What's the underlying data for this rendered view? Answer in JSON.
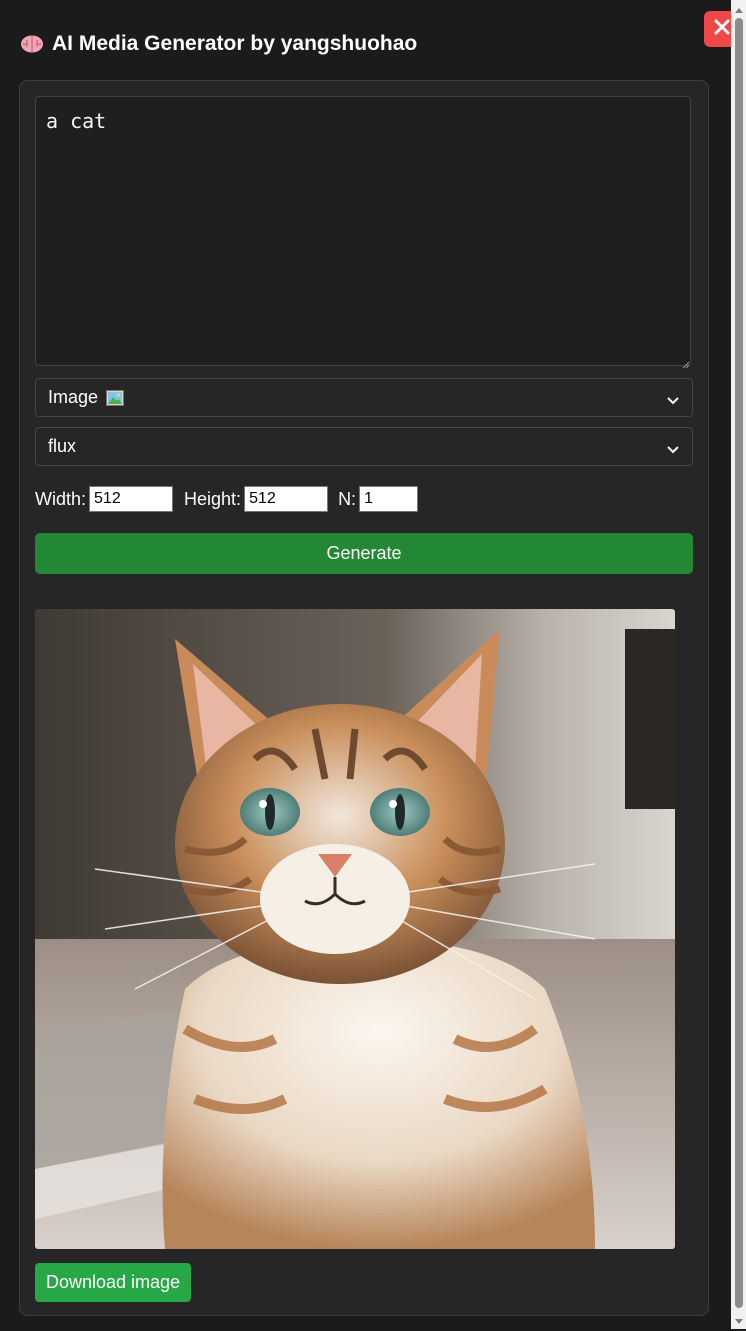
{
  "app": {
    "title": "AI Media Generator by yangshuohao",
    "title_icon": "brain-icon",
    "close_icon": "close-icon"
  },
  "form": {
    "prompt_value": "a cat",
    "media_type": {
      "selected": "Image",
      "icon": "picture-icon"
    },
    "model": {
      "selected": "flux"
    },
    "width_label": "Width:",
    "width_value": "512",
    "height_label": "Height:",
    "height_value": "512",
    "n_label": "N:",
    "n_value": "1",
    "generate_label": "Generate"
  },
  "result": {
    "image_description_icon": "generated-cat-image",
    "download_label": "Download image"
  },
  "colors": {
    "background": "#1b1b1b",
    "panel": "#262626",
    "generate": "#228834",
    "download": "#26a847",
    "close": "#f04848"
  }
}
